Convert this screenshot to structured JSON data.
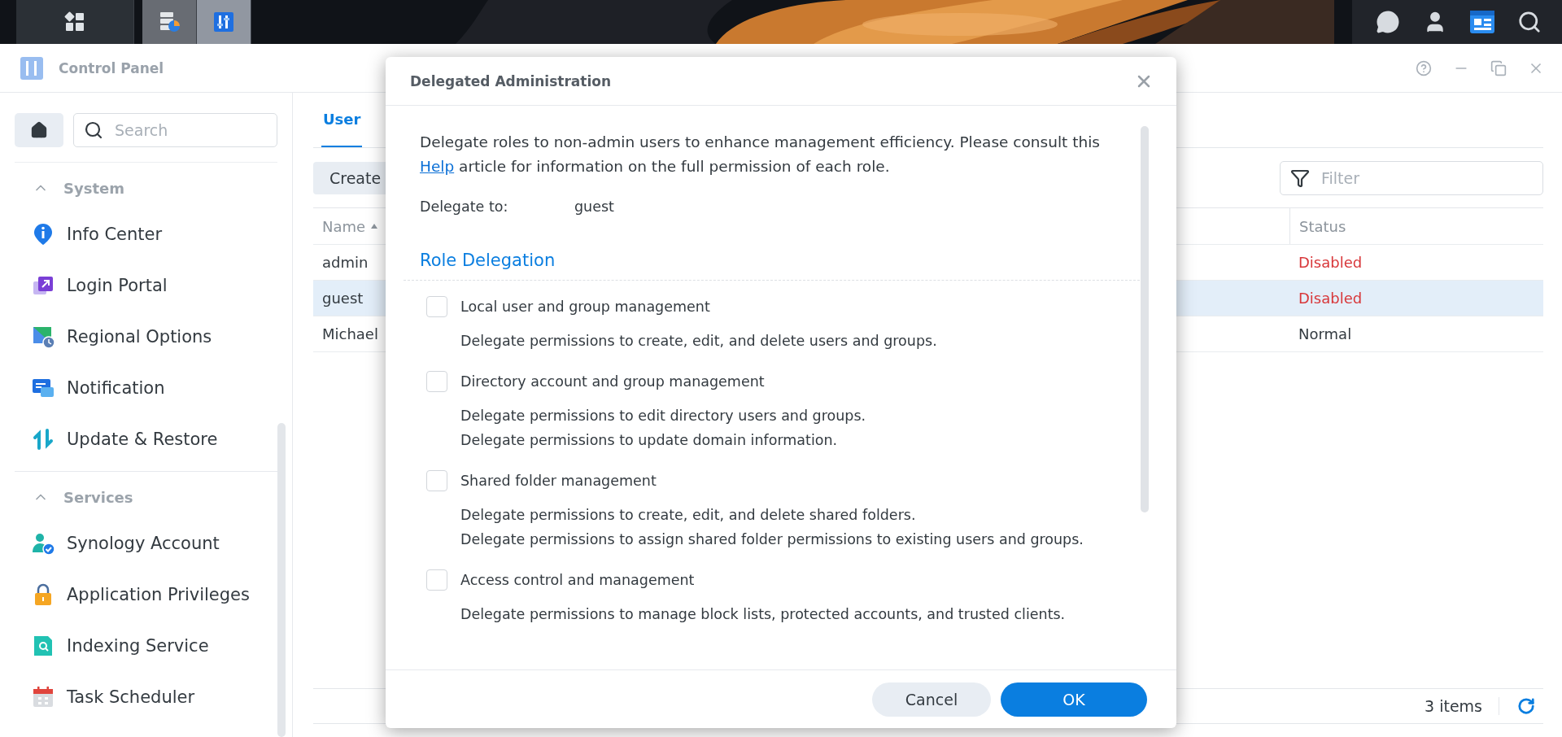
{
  "window": {
    "title": "Control Panel"
  },
  "sidebar": {
    "search": {
      "placeholder": "Search"
    },
    "sections": [
      {
        "title": "System",
        "expanded": true,
        "items": [
          {
            "label": "Info Center",
            "kind": "info"
          },
          {
            "label": "Login Portal",
            "kind": "portal"
          },
          {
            "label": "Regional Options",
            "kind": "regional"
          },
          {
            "label": "Notification",
            "kind": "notification"
          },
          {
            "label": "Update & Restore",
            "kind": "update"
          }
        ]
      },
      {
        "title": "Services",
        "expanded": true,
        "items": [
          {
            "label": "Synology Account",
            "kind": "account"
          },
          {
            "label": "Application Privileges",
            "kind": "privileges"
          },
          {
            "label": "Indexing Service",
            "kind": "indexing"
          },
          {
            "label": "Task Scheduler",
            "kind": "scheduler"
          }
        ]
      }
    ]
  },
  "tabs": [
    {
      "label": "User",
      "selected": true
    }
  ],
  "toolbar": {
    "buttons": [
      "Create"
    ],
    "filter": {
      "placeholder": "Filter"
    }
  },
  "table": {
    "columns": [
      {
        "label": "Name",
        "sorted": true
      },
      {
        "label": "Status",
        "sorted": false
      }
    ],
    "rows": [
      {
        "name": "admin",
        "status": "Disabled",
        "color": "#d8373a",
        "selected": false
      },
      {
        "name": "guest",
        "status": "Disabled",
        "color": "#d8373a",
        "selected": true
      },
      {
        "name": "Michael",
        "status": "Normal",
        "color": "#333a40",
        "selected": false
      }
    ]
  },
  "footer": {
    "count": "3 items"
  },
  "dialog": {
    "title": "Delegated Administration",
    "intro": {
      "before": "Delegate roles to non-admin users to enhance management efficiency. Please consult this ",
      "link": "Help",
      "after": " article for information on the full permission of each role."
    },
    "delegate_to": {
      "label": "Delegate to:",
      "value": "guest"
    },
    "section_title": "Role Delegation",
    "roles": [
      {
        "label": "Local user and group management",
        "checked": false,
        "descriptions": [
          "Delegate permissions to create, edit, and delete users and groups."
        ]
      },
      {
        "label": "Directory account and group management",
        "checked": false,
        "descriptions": [
          "Delegate permissions to edit directory users and groups.",
          "Delegate permissions to update domain information."
        ]
      },
      {
        "label": "Shared folder management",
        "checked": false,
        "descriptions": [
          "Delegate permissions to create, edit, and delete shared folders.",
          "Delegate permissions to assign shared folder permissions to existing users and groups."
        ]
      },
      {
        "label": "Access control and management",
        "checked": false,
        "descriptions": [
          "Delegate permissions to manage block lists, protected accounts, and trusted clients."
        ]
      }
    ],
    "buttons": [
      {
        "label": "Cancel",
        "kind": "secondary"
      },
      {
        "label": "OK",
        "kind": "primary"
      }
    ]
  }
}
